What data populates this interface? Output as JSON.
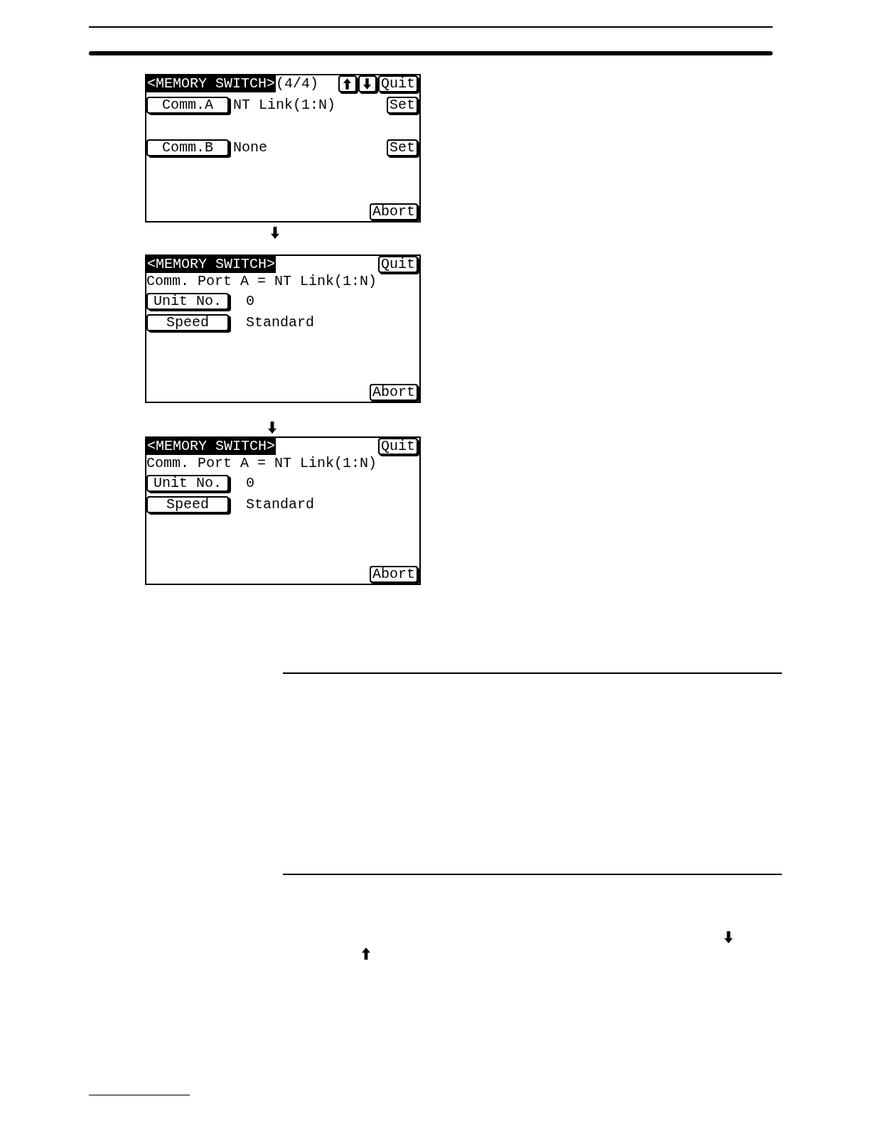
{
  "screens": [
    {
      "title": "<MEMORY SWITCH>",
      "page": "(4/4)",
      "header_buttons": [
        {
          "kind": "up"
        },
        {
          "kind": "down"
        },
        {
          "kind": "text",
          "label": "Quit"
        }
      ],
      "rows": [
        {
          "button": "Comm.A",
          "value": "NT Link(1:N)",
          "action": "Set"
        },
        {
          "button": "Comm.B",
          "value": "None",
          "action": "Set"
        }
      ],
      "footer_button": "Abort"
    },
    {
      "title": "<MEMORY SWITCH>",
      "header_buttons": [
        {
          "kind": "text",
          "label": "Quit"
        }
      ],
      "subtitle": "Comm. Port A = NT Link(1:N)",
      "rows": [
        {
          "button": "Unit No.",
          "value": "0"
        },
        {
          "button": "Speed",
          "value": "Standard"
        }
      ],
      "footer_button": "Abort"
    },
    {
      "title": "<MEMORY SWITCH>",
      "header_buttons": [
        {
          "kind": "text",
          "label": "Quit"
        }
      ],
      "subtitle": "Comm. Port A = NT Link(1:N)",
      "rows": [
        {
          "button": "Unit No.",
          "value": "0"
        },
        {
          "button": "Speed",
          "value": "Standard"
        }
      ],
      "footer_button": "Abort"
    }
  ]
}
